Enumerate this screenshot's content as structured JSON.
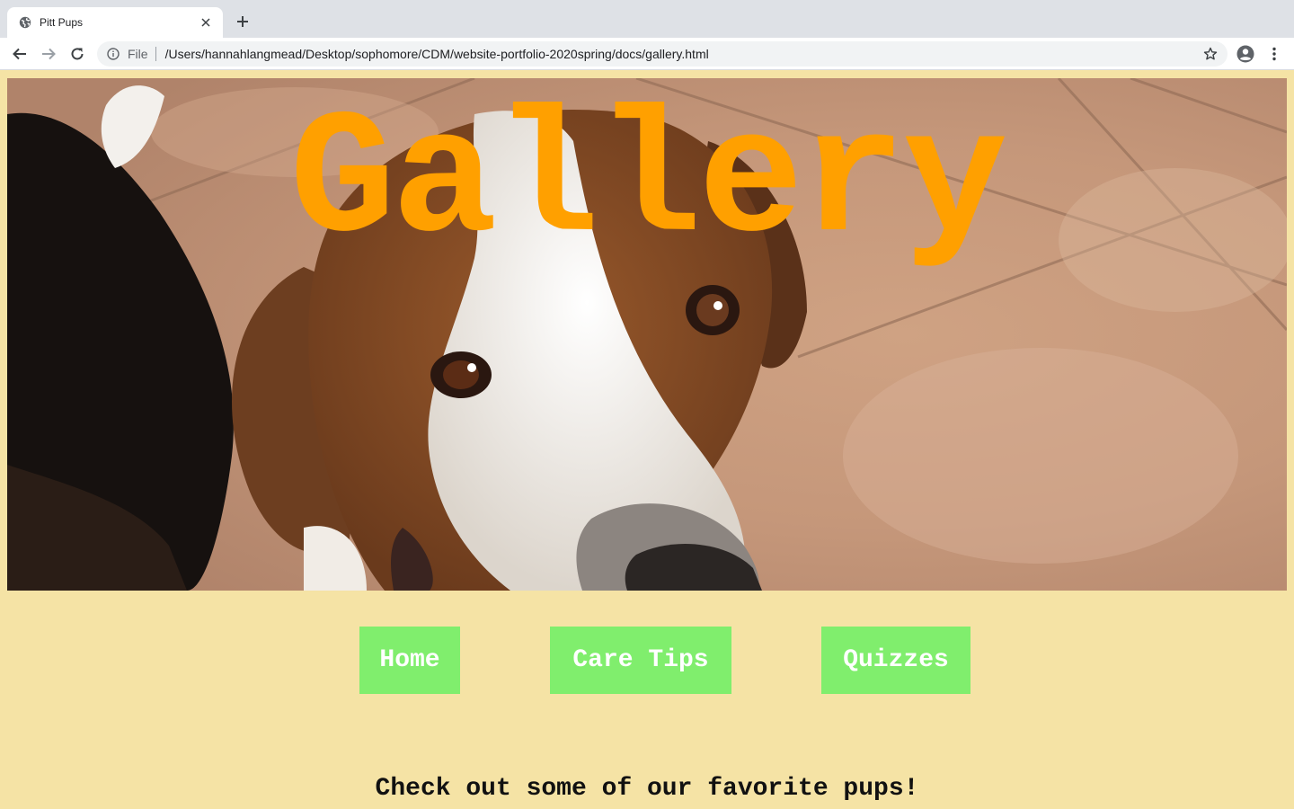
{
  "browser": {
    "tab_title": "Pitt Pups",
    "url_scheme": "File",
    "url": "/Users/hannahlangmead/Desktop/sophomore/CDM/website-portfolio-2020spring/docs/gallery.html",
    "icons": {
      "favicon": "globe-icon",
      "close": "close-icon",
      "new_tab": "plus-icon",
      "back": "back-arrow-icon",
      "forward": "forward-arrow-icon",
      "reload": "reload-icon",
      "info": "info-icon",
      "bookmark": "star-icon",
      "account": "account-icon",
      "menu": "kebab-menu-icon"
    }
  },
  "page": {
    "hero_title": "Gallery",
    "hero_image": "dog-photo",
    "nav": [
      {
        "label": "Home"
      },
      {
        "label": "Care Tips"
      },
      {
        "label": "Quizzes"
      }
    ],
    "tagline": "Check out some of our favorite pups!"
  },
  "colors": {
    "page_background": "#f5e3a5",
    "title_orange": "#ffa000",
    "nav_green": "#80ee6d",
    "nav_text": "#ffffff"
  }
}
